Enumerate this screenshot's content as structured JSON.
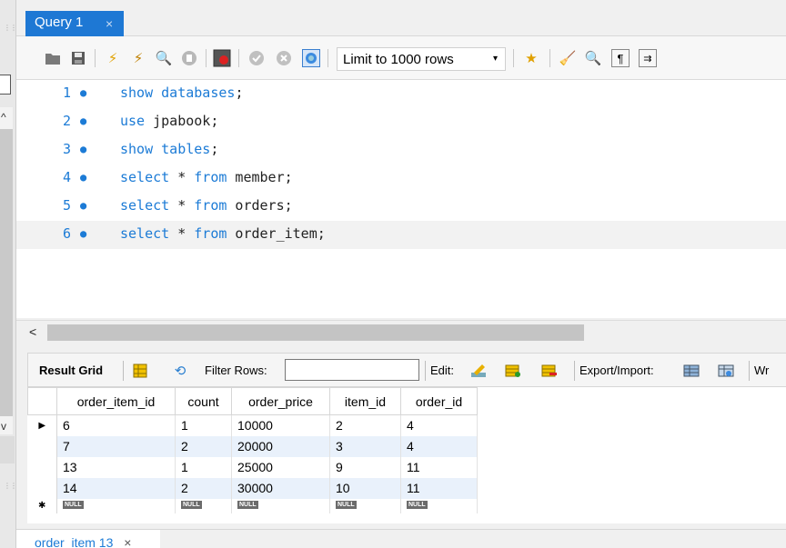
{
  "query_tab": {
    "title": "Query 1",
    "close": "×"
  },
  "toolbar": {
    "limit_label": "Limit to 1000 rows",
    "dropdown": "▾"
  },
  "editor": {
    "lines": [
      {
        "num": "1",
        "kw": "show databases",
        "rest": ";"
      },
      {
        "num": "2",
        "kw": "use",
        "rest": " jpabook;"
      },
      {
        "num": "3",
        "kw": "show tables",
        "rest": ";"
      },
      {
        "num": "4",
        "kw": "select",
        "mid": " * ",
        "kw2": "from",
        "rest": " member;"
      },
      {
        "num": "5",
        "kw": "select",
        "mid": " * ",
        "kw2": "from",
        "rest": " orders;"
      },
      {
        "num": "6",
        "kw": "select",
        "mid": " * ",
        "kw2": "from",
        "rest": " order_item;"
      }
    ]
  },
  "result_bar": {
    "result_grid": "Result Grid",
    "filter_rows": "Filter Rows:",
    "edit": "Edit:",
    "export_import": "Export/Import:",
    "wrap": "Wr"
  },
  "grid": {
    "columns": [
      "order_item_id",
      "count",
      "order_price",
      "item_id",
      "order_id"
    ],
    "rows": [
      [
        "6",
        "1",
        "10000",
        "2",
        "4"
      ],
      [
        "7",
        "2",
        "20000",
        "3",
        "4"
      ],
      [
        "13",
        "1",
        "25000",
        "9",
        "11"
      ],
      [
        "14",
        "2",
        "30000",
        "10",
        "11"
      ]
    ],
    "null_label": "NULL"
  },
  "bottom_tab": {
    "title": "order_item 13",
    "close": "×"
  }
}
